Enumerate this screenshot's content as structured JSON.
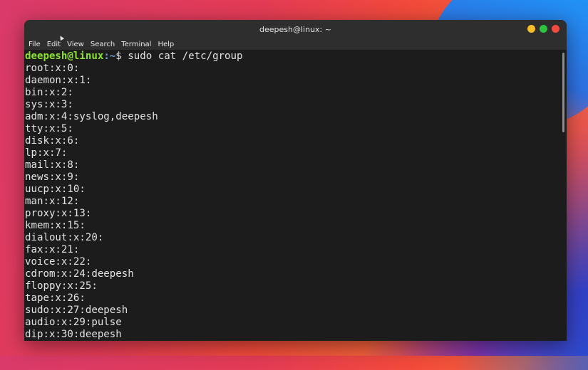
{
  "window": {
    "title": "deepesh@linux: ~",
    "controls": [
      "minimize-button",
      "maximize-button",
      "close-button"
    ]
  },
  "menubar": {
    "items": [
      "File",
      "Edit",
      "View",
      "Search",
      "Terminal",
      "Help"
    ]
  },
  "terminal": {
    "prompt_user": "deepesh@linux",
    "prompt_path": ":~",
    "prompt_symbol": "$ ",
    "command": "sudo cat /etc/group",
    "output": [
      "root:x:0:",
      "daemon:x:1:",
      "bin:x:2:",
      "sys:x:3:",
      "adm:x:4:syslog,deepesh",
      "tty:x:5:",
      "disk:x:6:",
      "lp:x:7:",
      "mail:x:8:",
      "news:x:9:",
      "uucp:x:10:",
      "man:x:12:",
      "proxy:x:13:",
      "kmem:x:15:",
      "dialout:x:20:",
      "fax:x:21:",
      "voice:x:22:",
      "cdrom:x:24:deepesh",
      "floppy:x:25:",
      "tape:x:26:",
      "sudo:x:27:deepesh",
      "audio:x:29:pulse",
      "dip:x:30:deepesh"
    ]
  },
  "colors": {
    "prompt_user": "#8ae234",
    "prompt_path": "#729fcf",
    "terminal_bg": "#1c1c1c",
    "close": "#f24b40",
    "minimize": "#f5bf2a",
    "maximize": "#2dc33d"
  }
}
